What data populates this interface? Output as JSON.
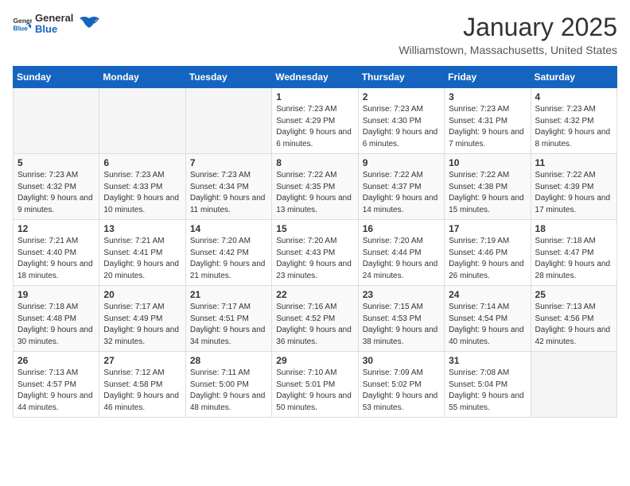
{
  "header": {
    "logo_general": "General",
    "logo_blue": "Blue",
    "title": "January 2025",
    "location": "Williamstown, Massachusetts, United States"
  },
  "days_of_week": [
    "Sunday",
    "Monday",
    "Tuesday",
    "Wednesday",
    "Thursday",
    "Friday",
    "Saturday"
  ],
  "weeks": [
    [
      {
        "day": "",
        "sunrise": "",
        "sunset": "",
        "daylight": ""
      },
      {
        "day": "",
        "sunrise": "",
        "sunset": "",
        "daylight": ""
      },
      {
        "day": "",
        "sunrise": "",
        "sunset": "",
        "daylight": ""
      },
      {
        "day": "1",
        "sunrise": "Sunrise: 7:23 AM",
        "sunset": "Sunset: 4:29 PM",
        "daylight": "Daylight: 9 hours and 6 minutes."
      },
      {
        "day": "2",
        "sunrise": "Sunrise: 7:23 AM",
        "sunset": "Sunset: 4:30 PM",
        "daylight": "Daylight: 9 hours and 6 minutes."
      },
      {
        "day": "3",
        "sunrise": "Sunrise: 7:23 AM",
        "sunset": "Sunset: 4:31 PM",
        "daylight": "Daylight: 9 hours and 7 minutes."
      },
      {
        "day": "4",
        "sunrise": "Sunrise: 7:23 AM",
        "sunset": "Sunset: 4:32 PM",
        "daylight": "Daylight: 9 hours and 8 minutes."
      }
    ],
    [
      {
        "day": "5",
        "sunrise": "Sunrise: 7:23 AM",
        "sunset": "Sunset: 4:32 PM",
        "daylight": "Daylight: 9 hours and 9 minutes."
      },
      {
        "day": "6",
        "sunrise": "Sunrise: 7:23 AM",
        "sunset": "Sunset: 4:33 PM",
        "daylight": "Daylight: 9 hours and 10 minutes."
      },
      {
        "day": "7",
        "sunrise": "Sunrise: 7:23 AM",
        "sunset": "Sunset: 4:34 PM",
        "daylight": "Daylight: 9 hours and 11 minutes."
      },
      {
        "day": "8",
        "sunrise": "Sunrise: 7:22 AM",
        "sunset": "Sunset: 4:35 PM",
        "daylight": "Daylight: 9 hours and 13 minutes."
      },
      {
        "day": "9",
        "sunrise": "Sunrise: 7:22 AM",
        "sunset": "Sunset: 4:37 PM",
        "daylight": "Daylight: 9 hours and 14 minutes."
      },
      {
        "day": "10",
        "sunrise": "Sunrise: 7:22 AM",
        "sunset": "Sunset: 4:38 PM",
        "daylight": "Daylight: 9 hours and 15 minutes."
      },
      {
        "day": "11",
        "sunrise": "Sunrise: 7:22 AM",
        "sunset": "Sunset: 4:39 PM",
        "daylight": "Daylight: 9 hours and 17 minutes."
      }
    ],
    [
      {
        "day": "12",
        "sunrise": "Sunrise: 7:21 AM",
        "sunset": "Sunset: 4:40 PM",
        "daylight": "Daylight: 9 hours and 18 minutes."
      },
      {
        "day": "13",
        "sunrise": "Sunrise: 7:21 AM",
        "sunset": "Sunset: 4:41 PM",
        "daylight": "Daylight: 9 hours and 20 minutes."
      },
      {
        "day": "14",
        "sunrise": "Sunrise: 7:20 AM",
        "sunset": "Sunset: 4:42 PM",
        "daylight": "Daylight: 9 hours and 21 minutes."
      },
      {
        "day": "15",
        "sunrise": "Sunrise: 7:20 AM",
        "sunset": "Sunset: 4:43 PM",
        "daylight": "Daylight: 9 hours and 23 minutes."
      },
      {
        "day": "16",
        "sunrise": "Sunrise: 7:20 AM",
        "sunset": "Sunset: 4:44 PM",
        "daylight": "Daylight: 9 hours and 24 minutes."
      },
      {
        "day": "17",
        "sunrise": "Sunrise: 7:19 AM",
        "sunset": "Sunset: 4:46 PM",
        "daylight": "Daylight: 9 hours and 26 minutes."
      },
      {
        "day": "18",
        "sunrise": "Sunrise: 7:18 AM",
        "sunset": "Sunset: 4:47 PM",
        "daylight": "Daylight: 9 hours and 28 minutes."
      }
    ],
    [
      {
        "day": "19",
        "sunrise": "Sunrise: 7:18 AM",
        "sunset": "Sunset: 4:48 PM",
        "daylight": "Daylight: 9 hours and 30 minutes."
      },
      {
        "day": "20",
        "sunrise": "Sunrise: 7:17 AM",
        "sunset": "Sunset: 4:49 PM",
        "daylight": "Daylight: 9 hours and 32 minutes."
      },
      {
        "day": "21",
        "sunrise": "Sunrise: 7:17 AM",
        "sunset": "Sunset: 4:51 PM",
        "daylight": "Daylight: 9 hours and 34 minutes."
      },
      {
        "day": "22",
        "sunrise": "Sunrise: 7:16 AM",
        "sunset": "Sunset: 4:52 PM",
        "daylight": "Daylight: 9 hours and 36 minutes."
      },
      {
        "day": "23",
        "sunrise": "Sunrise: 7:15 AM",
        "sunset": "Sunset: 4:53 PM",
        "daylight": "Daylight: 9 hours and 38 minutes."
      },
      {
        "day": "24",
        "sunrise": "Sunrise: 7:14 AM",
        "sunset": "Sunset: 4:54 PM",
        "daylight": "Daylight: 9 hours and 40 minutes."
      },
      {
        "day": "25",
        "sunrise": "Sunrise: 7:13 AM",
        "sunset": "Sunset: 4:56 PM",
        "daylight": "Daylight: 9 hours and 42 minutes."
      }
    ],
    [
      {
        "day": "26",
        "sunrise": "Sunrise: 7:13 AM",
        "sunset": "Sunset: 4:57 PM",
        "daylight": "Daylight: 9 hours and 44 minutes."
      },
      {
        "day": "27",
        "sunrise": "Sunrise: 7:12 AM",
        "sunset": "Sunset: 4:58 PM",
        "daylight": "Daylight: 9 hours and 46 minutes."
      },
      {
        "day": "28",
        "sunrise": "Sunrise: 7:11 AM",
        "sunset": "Sunset: 5:00 PM",
        "daylight": "Daylight: 9 hours and 48 minutes."
      },
      {
        "day": "29",
        "sunrise": "Sunrise: 7:10 AM",
        "sunset": "Sunset: 5:01 PM",
        "daylight": "Daylight: 9 hours and 50 minutes."
      },
      {
        "day": "30",
        "sunrise": "Sunrise: 7:09 AM",
        "sunset": "Sunset: 5:02 PM",
        "daylight": "Daylight: 9 hours and 53 minutes."
      },
      {
        "day": "31",
        "sunrise": "Sunrise: 7:08 AM",
        "sunset": "Sunset: 5:04 PM",
        "daylight": "Daylight: 9 hours and 55 minutes."
      },
      {
        "day": "",
        "sunrise": "",
        "sunset": "",
        "daylight": ""
      }
    ]
  ]
}
